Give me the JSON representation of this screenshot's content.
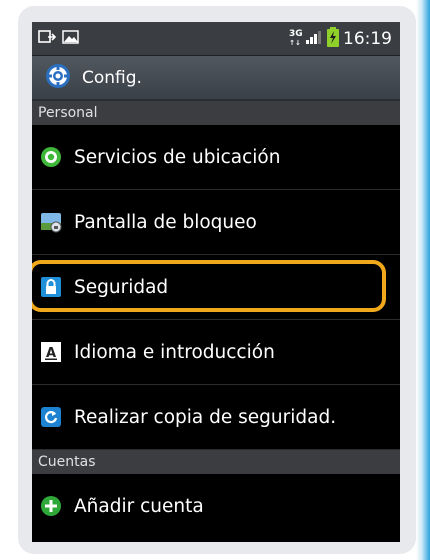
{
  "status_bar": {
    "network_top": "3G",
    "network_bottom": "↑↓",
    "clock": "16:19"
  },
  "header": {
    "icon": "gear-icon",
    "title": "Config."
  },
  "sections": [
    {
      "label": "Personal",
      "items": [
        {
          "label": "Servicios de ubicación",
          "icon": "location-icon"
        },
        {
          "label": "Pantalla de bloqueo",
          "icon": "lock-screen-icon"
        },
        {
          "label": "Seguridad",
          "icon": "padlock-icon",
          "highlighted": true
        },
        {
          "label": "Idioma e introducción",
          "icon": "language-icon"
        },
        {
          "label": "Realizar copia de seguridad.",
          "icon": "backup-icon"
        }
      ]
    },
    {
      "label": "Cuentas",
      "items": [
        {
          "label": "Añadir cuenta",
          "icon": "add-account-icon"
        }
      ]
    }
  ],
  "colors": {
    "highlight": "#f2a81b",
    "location_icon": "#3fb83a",
    "security_icon": "#1f8fd9",
    "backup_icon": "#1e82d2",
    "add_icon": "#2fa83a"
  }
}
